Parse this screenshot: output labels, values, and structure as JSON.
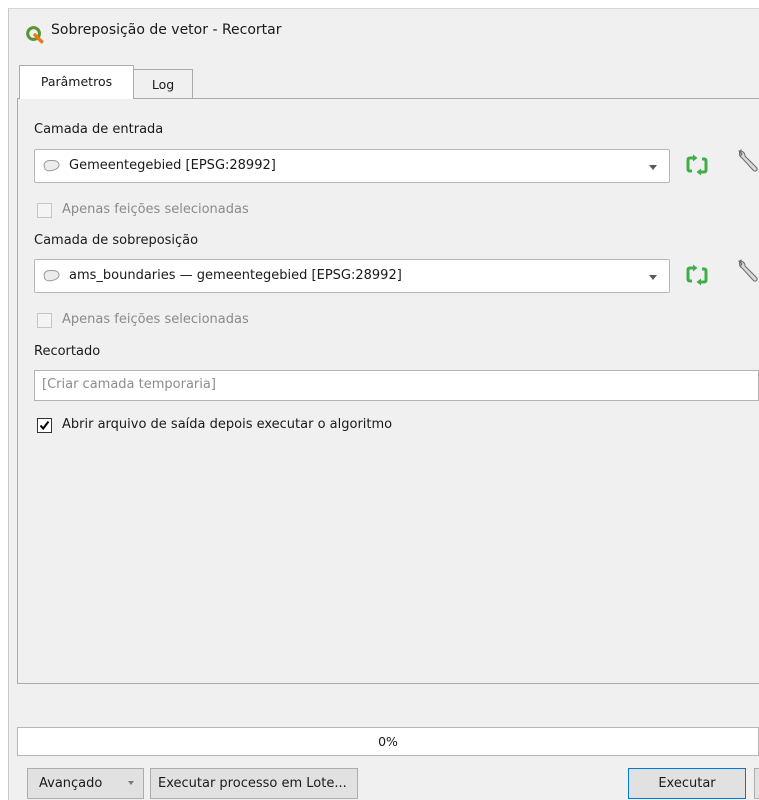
{
  "window": {
    "title": "Sobreposição de vetor - Recortar"
  },
  "tabs": [
    {
      "label": "Parâmetros",
      "active": true
    },
    {
      "label": "Log",
      "active": false
    }
  ],
  "params": {
    "input_layer": {
      "label": "Camada de entrada",
      "value": "Gemeentegebied [EPSG:28992]",
      "selected_only_label": "Apenas feições selecionadas",
      "selected_only_checked": false
    },
    "overlay_layer": {
      "label": "Camada de sobreposição",
      "value": "ams_boundaries — gemeentegebied [EPSG:28992]",
      "selected_only_label": "Apenas feições selecionadas",
      "selected_only_checked": false
    },
    "output": {
      "label": "Recortado",
      "placeholder": "[Criar camada temporaria]"
    },
    "open_output": {
      "label": "Abrir arquivo de saída depois executar o algoritmo",
      "checked": true
    }
  },
  "progress": {
    "text": "0%",
    "value": 0
  },
  "buttons": {
    "advanced": "Avançado",
    "batch": "Executar processo em Lote...",
    "run": "Executar"
  },
  "colors": {
    "iterate_icon": "#3fae49",
    "qgis_logo": "#589632",
    "progress_fill": "#06b025"
  },
  "icons": {
    "app": "qgis-logo-icon",
    "layer": "polygon-layer-icon",
    "iterate": "iterate-icon",
    "settings": "wrench-icon",
    "dropdown": "chevron-down-icon",
    "check": "checkmark-icon"
  }
}
